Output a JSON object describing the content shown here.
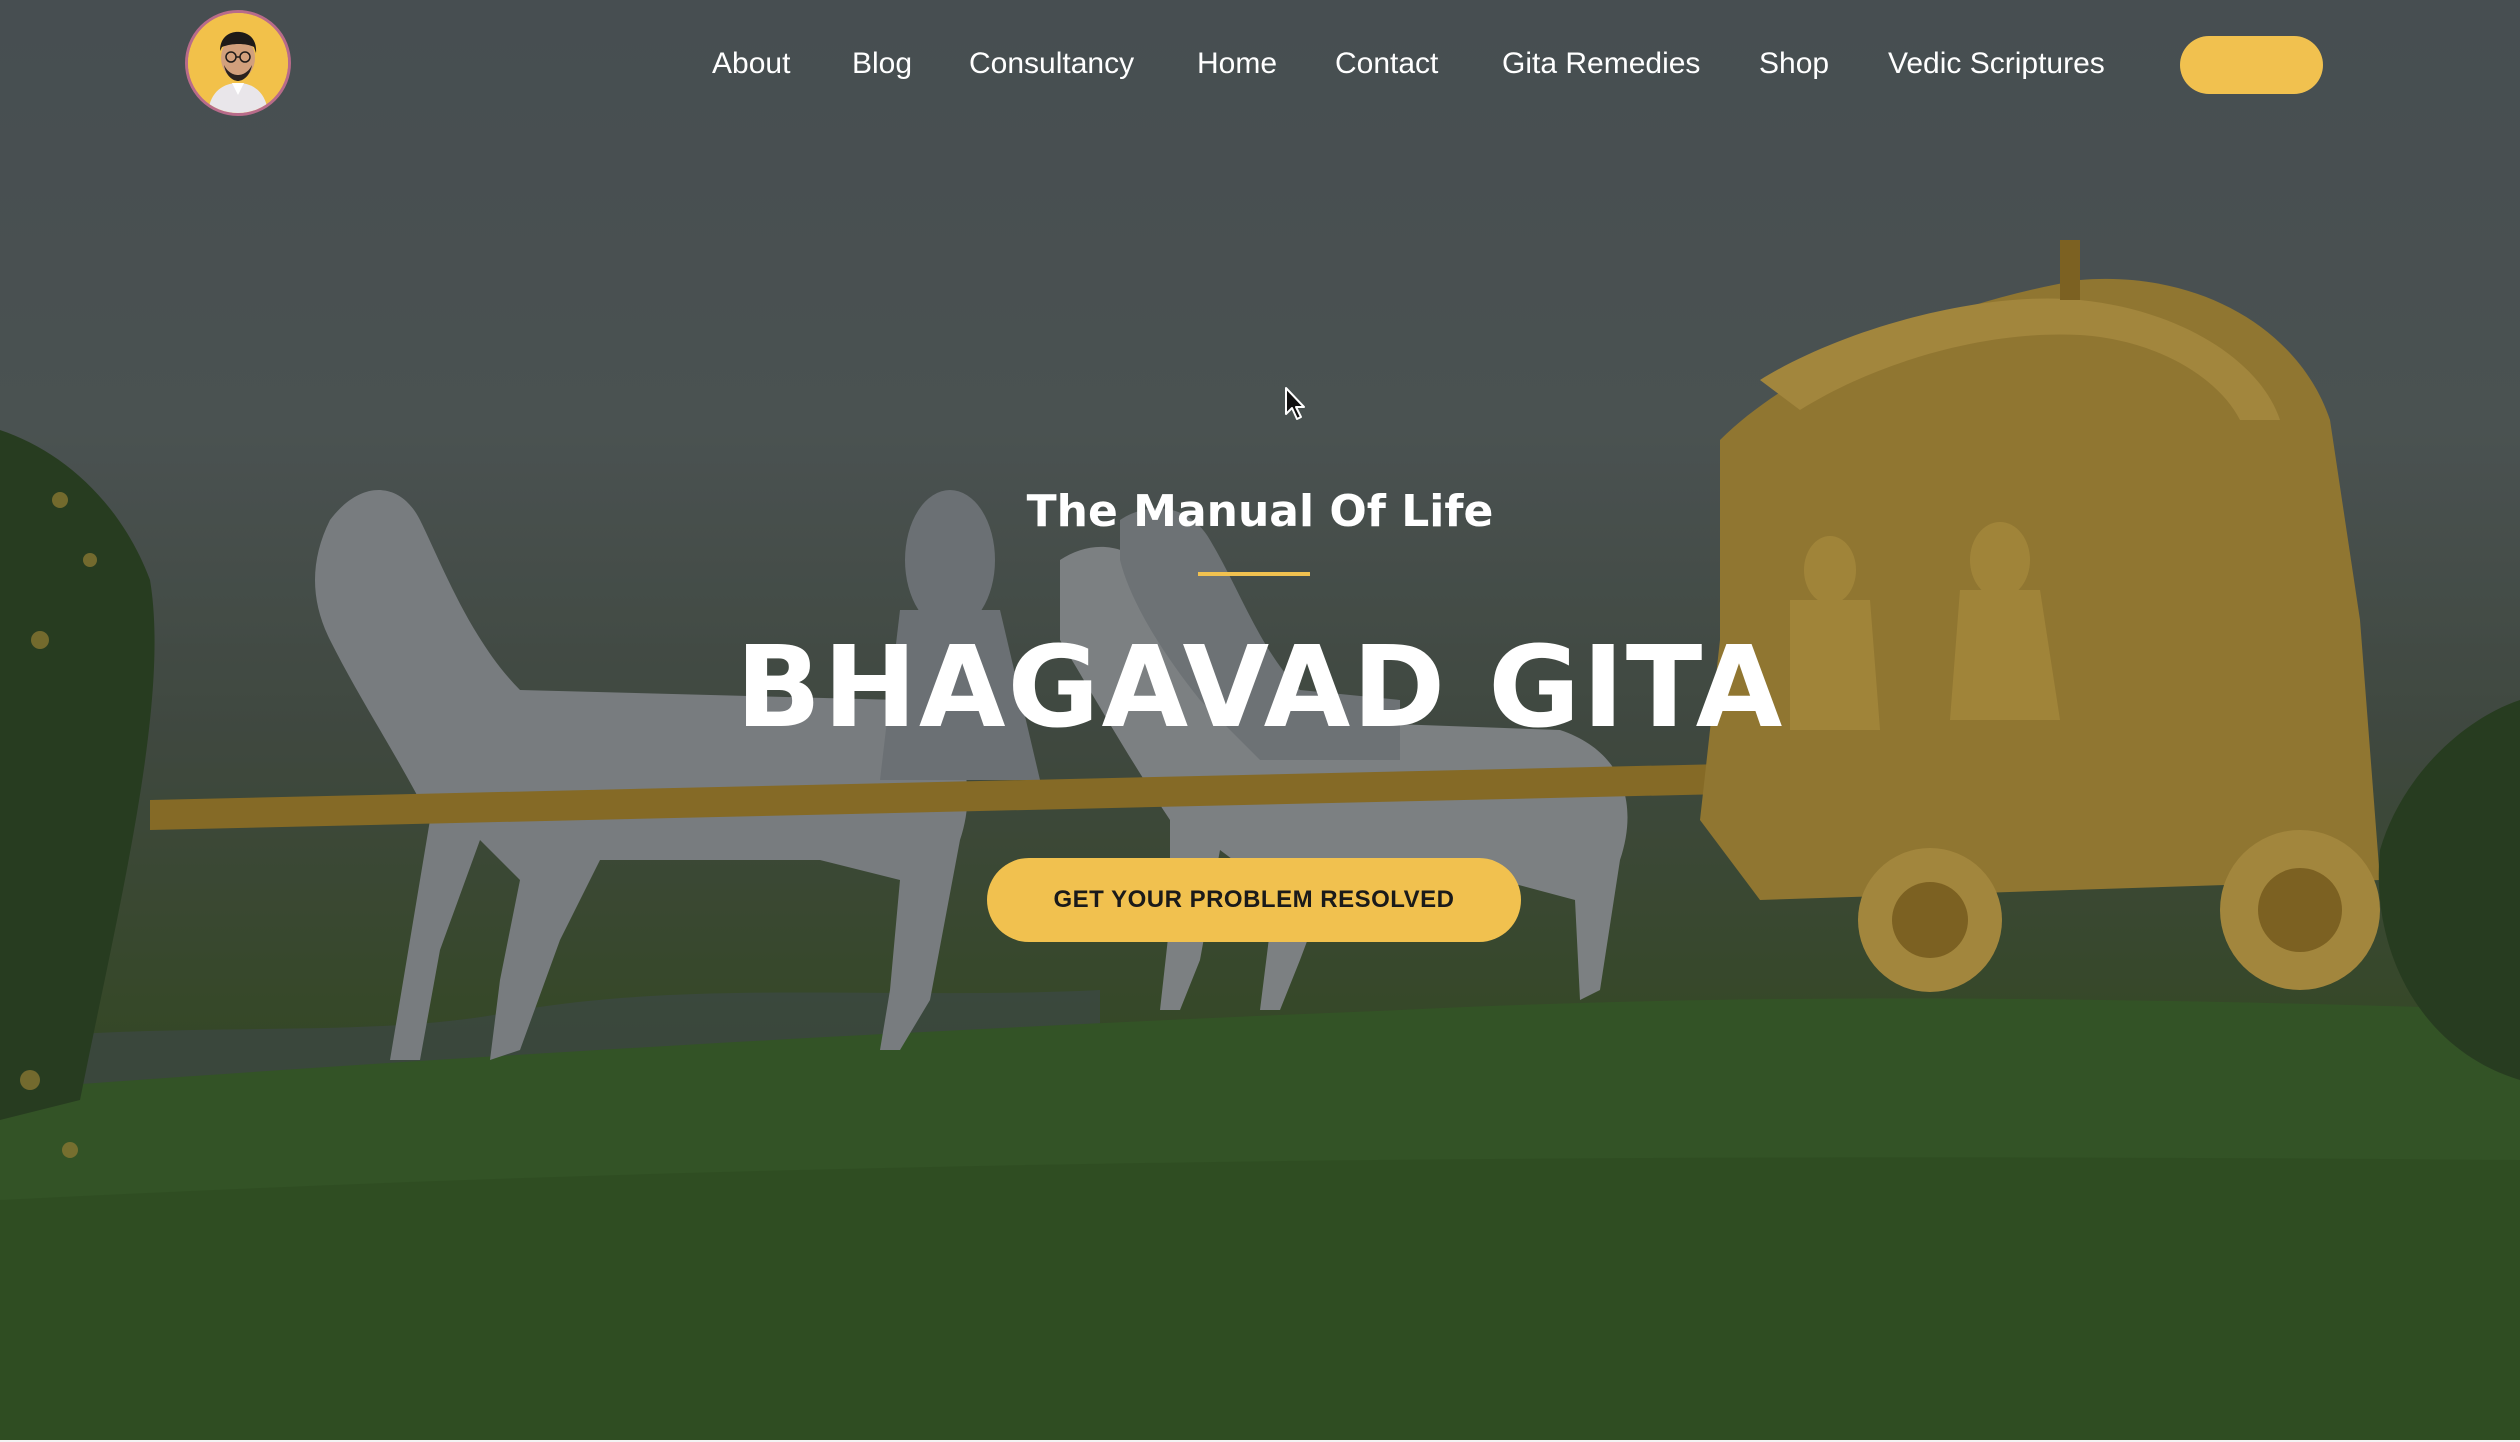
{
  "header": {
    "logo_alt": "profile-avatar",
    "nav_items": [
      "About",
      "Blog",
      "Consultancy",
      "Home",
      "Contact",
      "Gita Remedies",
      "Shop",
      "Vedic Scriptures"
    ],
    "cta_label": ""
  },
  "hero": {
    "subtitle": "The Manual Of Life",
    "title": "BHAGAVAD GITA",
    "cta_label": "GET YOUR PROBLEM RESOLVED"
  },
  "colors": {
    "accent": "#f1c14f",
    "text": "#ffffff",
    "button_text": "#1a1a1a"
  },
  "icons": {
    "cursor": "mouse-pointer-icon"
  }
}
